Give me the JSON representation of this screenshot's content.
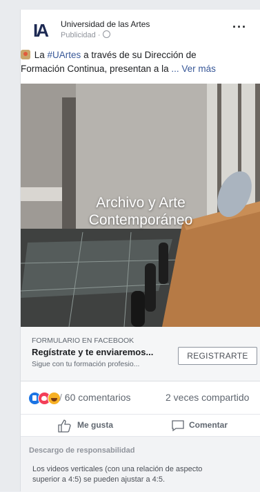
{
  "post": {
    "page_name": "Universidad de las Artes",
    "sponsored_label": "Publicidad · ",
    "logo_text": "IA",
    "more_label": "···",
    "text_line1_pre": " La ",
    "text_hashtag": "#UArtes",
    "text_line1_post": " a través de su Dirección de",
    "text_line2": "Formación Continua, presentan a la",
    "see_more": "... Ver más"
  },
  "media": {
    "title_line1": "Archivo y Arte",
    "title_line2": "Contemporáneo"
  },
  "cta": {
    "caption": "FORMULARIO EN FACEBOOK",
    "headline": "Regístrate y te enviaremos...",
    "description": "Sigue con tu formación profesio...",
    "button_label": "REGISTRARTE"
  },
  "stats": {
    "comments": "60 comentarios",
    "shares": "2 veces compartido"
  },
  "actions": {
    "like_label": "Me gusta",
    "comment_label": "Comentar"
  },
  "disclaimer": {
    "title": "Descargo de responsabilidad",
    "body_line1": "Los videos verticales (con una relación de aspecto",
    "body_line2": "superior a 4:5) se pueden ajustar a 4:5."
  },
  "colors": {
    "link": "#385898",
    "like": "#1b74e4",
    "love": "#f33e58",
    "haha": "#f7b125"
  }
}
